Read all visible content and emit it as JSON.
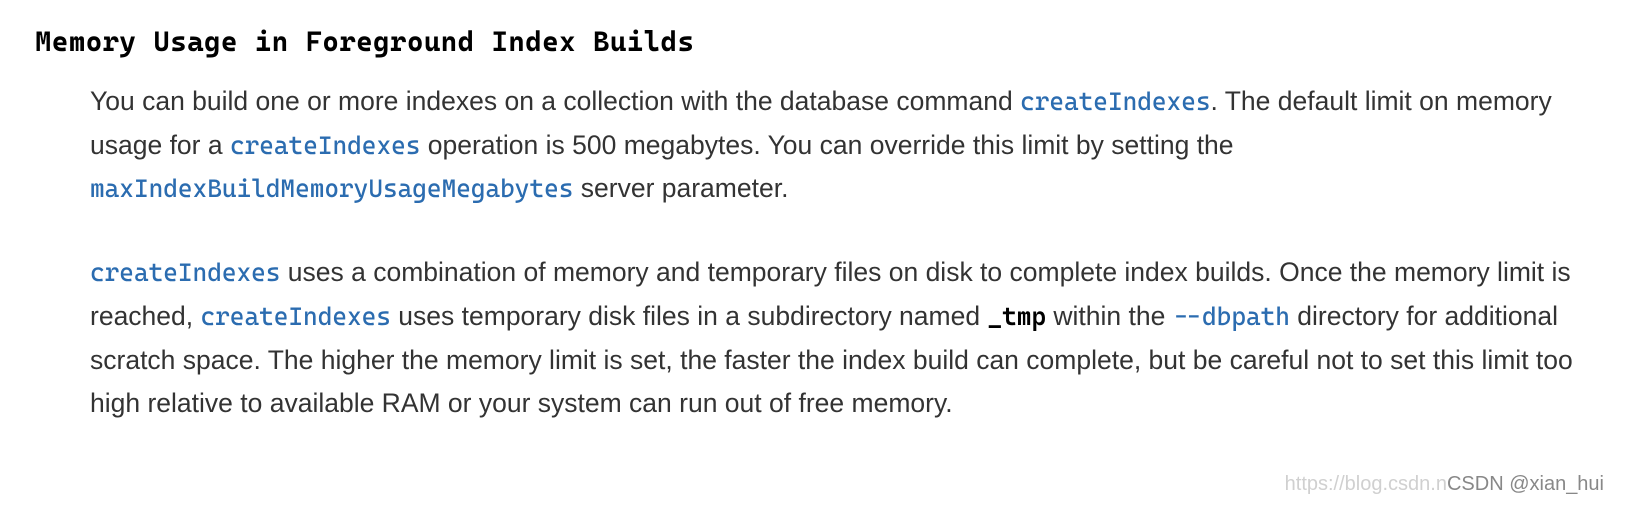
{
  "heading": "Memory Usage in Foreground Index Builds",
  "paragraph1": {
    "part1": "You can build one or more indexes on a collection with the database command ",
    "link1": "createIndexes",
    "part2": ". The default limit on memory usage for a ",
    "link2": "createIndexes",
    "part3": " operation is 500 megabytes. You can override this limit by setting the ",
    "link3": "maxIndexBuildMemoryUsageMegabytes",
    "part4": " server parameter."
  },
  "paragraph2": {
    "link1": "createIndexes",
    "part1": " uses a combination of memory and temporary files on disk to complete index builds. Once the memory limit is reached, ",
    "link2": "createIndexes",
    "part2": " uses temporary disk files in a subdirectory named ",
    "code1": "_tmp",
    "part3": " within the ",
    "link3": "--dbpath",
    "part4": " directory for additional scratch space. The higher the memory limit is set, the faster the index build can complete, but be careful not to set this limit too high relative to available RAM or your system can run out of free memory."
  },
  "watermark": {
    "url_prefix": "https://blog.csdn.n",
    "attribution": "CSDN @xian_hui"
  }
}
